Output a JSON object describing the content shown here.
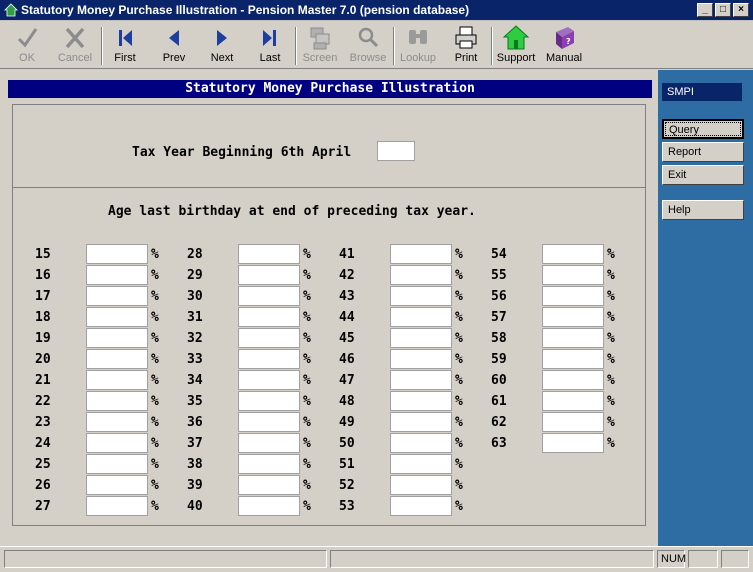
{
  "window": {
    "title": "Statutory Money Purchase Illustration - Pension Master 7.0 (pension database)"
  },
  "titlebar_buttons": {
    "minimize": "_",
    "maximize": "□",
    "close": "×"
  },
  "toolbar": {
    "ok": "OK",
    "cancel": "Cancel",
    "first": "First",
    "prev": "Prev",
    "next": "Next",
    "last": "Last",
    "screen": "Screen",
    "browse": "Browse",
    "lookup": "Lookup",
    "print": "Print",
    "support": "Support",
    "manual": "Manual"
  },
  "form": {
    "header": "Statutory Money Purchase Illustration",
    "tax_year_label": "Tax Year Beginning 6th April",
    "tax_year_value": "",
    "age_label": "Age last birthday at end of preceding tax year.",
    "percent_symbol": "%",
    "ages": {
      "col1": [
        "15",
        "16",
        "17",
        "18",
        "19",
        "20",
        "21",
        "22",
        "23",
        "24",
        "25",
        "26",
        "27"
      ],
      "col2": [
        "28",
        "29",
        "30",
        "31",
        "32",
        "33",
        "34",
        "35",
        "36",
        "37",
        "38",
        "39",
        "40"
      ],
      "col3": [
        "41",
        "42",
        "43",
        "44",
        "45",
        "46",
        "47",
        "48",
        "49",
        "50",
        "51",
        "52",
        "53"
      ],
      "col4": [
        "54",
        "55",
        "56",
        "57",
        "58",
        "59",
        "60",
        "61",
        "62",
        "63"
      ]
    }
  },
  "side": {
    "title": "SMPI",
    "query": "Query",
    "report": "Report",
    "exit": "Exit",
    "help": "Help"
  },
  "status": {
    "num": "NUM"
  },
  "colors": {
    "title_bar": "#0a246a",
    "side_panel": "#2e6ca4",
    "form_header": "#000080"
  }
}
